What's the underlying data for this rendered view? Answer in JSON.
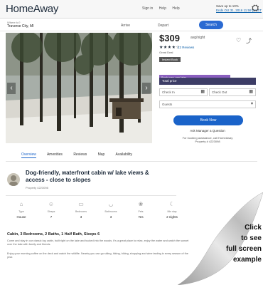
{
  "header": {
    "logo": "HomeAway",
    "nav": [
      "Sign in",
      "Help",
      "Help"
    ],
    "promo_line1": "Save up to 10%",
    "promo_line2": "Ends Oct 31, 2016 11:59 pm ET"
  },
  "search": {
    "where_label": "Where to?",
    "where_value": "Traverse City, MI",
    "arrive": "Arrive",
    "depart": "Depart",
    "button": "Search"
  },
  "booking": {
    "price": "$309",
    "per_night": "avg/night",
    "stars": "★★★★☆",
    "reviews": "12 Reviews",
    "deal": "Great Deal",
    "tag": "Instant Book",
    "purple_bar": "Book now, pay later",
    "dark_bar": "Total price",
    "checkin": "Check In",
    "checkout": "Check Out",
    "guests": "Guests",
    "book_button": "Book Now",
    "ask": "Ask Manager a Question",
    "note_line1": "For booking assistance, call HomeAway",
    "note_line2": "Property # 4223098"
  },
  "tabs": [
    "Overview",
    "Amenities",
    "Reviews",
    "Map",
    "Availability"
  ],
  "listing": {
    "title": "Dog-friendly, waterfront cabin w/ lake views & access - close to slopes",
    "property_id": "Property 4223098"
  },
  "facts": [
    {
      "icon": "home-icon",
      "label": "Type",
      "value": "House"
    },
    {
      "icon": "person-icon",
      "label": "Sleeps",
      "value": "7"
    },
    {
      "icon": "bed-icon",
      "label": "Bedrooms",
      "value": "3"
    },
    {
      "icon": "bath-icon",
      "label": "Bathrooms",
      "value": "3"
    },
    {
      "icon": "pet-icon",
      "label": "Pets",
      "value": "Yes"
    },
    {
      "icon": "nights-icon",
      "label": "Min stay",
      "value": "2 nights"
    }
  ],
  "summary": {
    "title": "Cabin, 3 Bedrooms, 2 Baths, 1 Half Bath, Sleeps 6",
    "text1": "Come and stay in our classic log cabin, built right on the lake and tucked into the woods. It's a great place to relax, enjoy the water and watch the sunset over the lake with family and friends.",
    "text2": "Enjoy your morning coffee on the deck and watch the wildlife. Nearby you can go skiing, hiking, biking, shopping and wine tasting in every season of the year."
  },
  "corner": {
    "line1": "Click",
    "line2": "to see",
    "line3": "full screen",
    "line4": "example"
  },
  "colors": {
    "accent": "#1a63c9",
    "purple": "#8a5fbf",
    "navy": "#3d3d66"
  }
}
